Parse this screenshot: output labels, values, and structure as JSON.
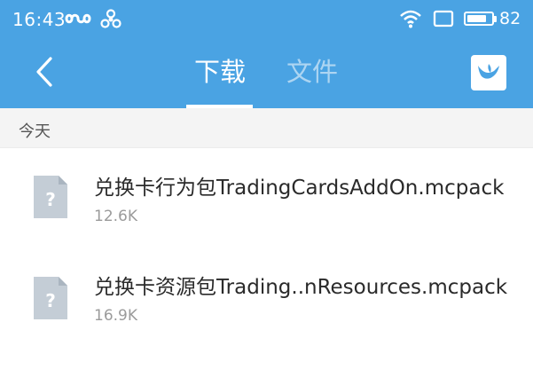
{
  "status_bar": {
    "time": "16:43",
    "battery_level": "82",
    "battery_fraction": 0.82,
    "icons": [
      "infinity-icon",
      "fan-icon",
      "wifi-icon",
      "screen-icon",
      "battery-icon"
    ]
  },
  "header": {
    "tabs": [
      {
        "label": "下载",
        "active": true
      },
      {
        "label": "文件",
        "active": false
      }
    ],
    "background_color": "#4aa3e3"
  },
  "section": {
    "label": "今天"
  },
  "files": [
    {
      "name": "兑换卡行为包TradingCardsAddOn.mcpack",
      "size": "12.6K",
      "icon": "unknown-file-icon"
    },
    {
      "name": "兑换卡资源包Trading..nResources.mcpack",
      "size": "16.9K",
      "icon": "unknown-file-icon"
    }
  ]
}
